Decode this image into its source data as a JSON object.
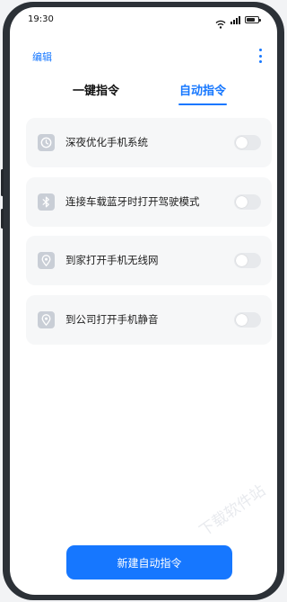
{
  "status_bar": {
    "time": "19:30"
  },
  "header": {
    "edit_label": "编辑"
  },
  "tabs": [
    {
      "label": "一键指令",
      "active": false
    },
    {
      "label": "自动指令",
      "active": true
    }
  ],
  "commands": [
    {
      "icon": "clock-icon",
      "label": "深夜优化手机系统",
      "enabled": false
    },
    {
      "icon": "bluetooth-icon",
      "label": "连接车载蓝牙时打开驾驶模式",
      "enabled": false
    },
    {
      "icon": "location-icon",
      "label": "到家打开手机无线网",
      "enabled": false
    },
    {
      "icon": "location-icon",
      "label": "到公司打开手机静音",
      "enabled": false
    }
  ],
  "new_button_label": "新建自动指令",
  "watermark": "下载软件站",
  "colors": {
    "accent": "#1677ff",
    "card_bg": "#f6f7f8",
    "icon_bg": "#c9ced6",
    "toggle_off": "#e7e9ec"
  }
}
